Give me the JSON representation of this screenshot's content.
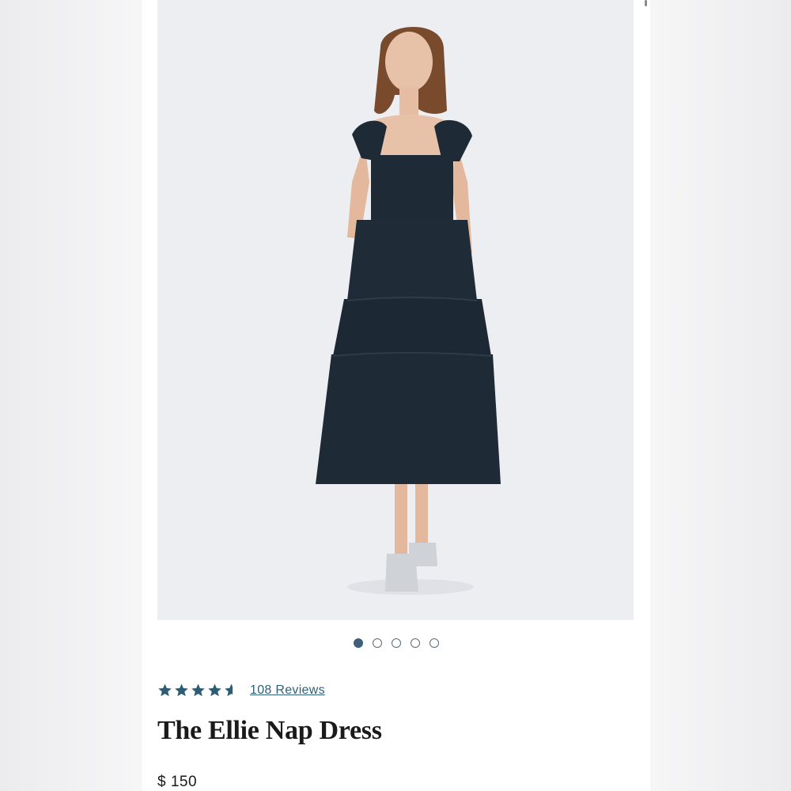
{
  "product": {
    "title": "The Ellie Nap Dress",
    "price": "$ 150",
    "rating": 4.5,
    "rating_max": 5,
    "reviews_label": "108 Reviews",
    "image": {
      "description_icon": "product-photo",
      "background_color": "#eceef2",
      "dress_color": "#1e2a35"
    }
  },
  "carousel": {
    "count": 5,
    "active_index": 0
  },
  "colors": {
    "accent": "#2f6177",
    "star": "#2d5d74",
    "text": "#1a1a1a"
  }
}
